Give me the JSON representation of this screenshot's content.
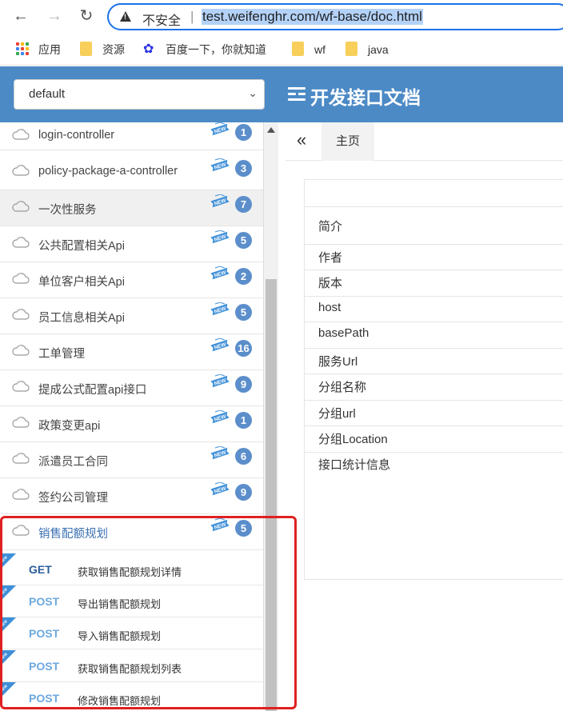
{
  "browser": {
    "insecure_label": "不安全",
    "separator": "|",
    "url": "test.weifenghr.com/wf-base/doc.html",
    "bookmarks": [
      {
        "label": "应用",
        "icon": "apps-grid-icon"
      },
      {
        "label": "资源",
        "icon": "folder-icon"
      },
      {
        "label": "百度一下，你就知道",
        "icon": "baidu-paw-icon"
      },
      {
        "label": "wf",
        "icon": "folder-icon"
      },
      {
        "label": "java",
        "icon": "folder-icon"
      }
    ]
  },
  "header": {
    "group_select": "default",
    "title": "开发接口文档"
  },
  "sidebar": {
    "items": [
      {
        "label": "login-controller",
        "count": "1"
      },
      {
        "label": "policy-package-a-controller",
        "count": "3"
      },
      {
        "label": "一次性服务",
        "count": "7"
      },
      {
        "label": "公共配置相关Api",
        "count": "5"
      },
      {
        "label": "单位客户相关Api",
        "count": "2"
      },
      {
        "label": "员工信息相关Api",
        "count": "5"
      },
      {
        "label": "工单管理",
        "count": "16"
      },
      {
        "label": "提成公式配置api接口",
        "count": "9"
      },
      {
        "label": "政策变更api",
        "count": "1"
      },
      {
        "label": "派遣员工合同",
        "count": "6"
      },
      {
        "label": "签约公司管理",
        "count": "9"
      },
      {
        "label": "销售配额规划",
        "count": "5"
      }
    ],
    "apis": [
      {
        "method": "GET",
        "summary": "获取销售配额规划详情"
      },
      {
        "method": "POST",
        "summary": "导出销售配额规划"
      },
      {
        "method": "POST",
        "summary": "导入销售配额规划"
      },
      {
        "method": "POST",
        "summary": "获取销售配额规划列表"
      },
      {
        "method": "POST",
        "summary": "修改销售配额规划"
      }
    ],
    "new_badge": "NEW"
  },
  "main": {
    "collapse_glyph": "«",
    "tab_home": "主页",
    "info_rows": [
      "简介",
      "作者",
      "版本",
      "host",
      "basePath",
      "服务Url",
      "分组名称",
      "分组url",
      "分组Location",
      "接口统计信息"
    ]
  },
  "colors": {
    "header_bg": "#4c8ac6",
    "badge_bg": "#5b8ecb",
    "highlight": "#e02020",
    "get": "#2b5d9c",
    "post": "#6da8e0"
  }
}
